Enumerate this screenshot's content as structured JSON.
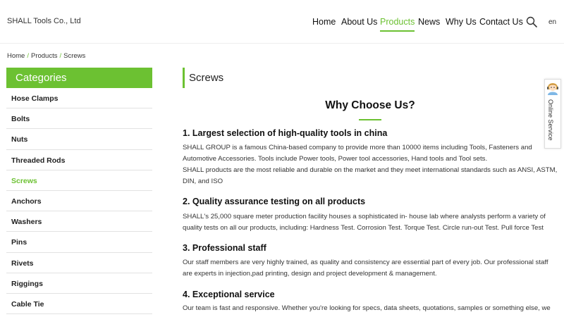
{
  "header": {
    "company": "SHALL Tools Co., Ltd",
    "nav": [
      {
        "label": "Home"
      },
      {
        "label": "About Us"
      },
      {
        "label": "Products"
      },
      {
        "label": "News"
      },
      {
        "label": "Why Us"
      },
      {
        "label": "Contact Us"
      }
    ],
    "active_nav": "Products",
    "search_icon": "search-icon",
    "lang": "en"
  },
  "breadcrumb": {
    "items": [
      "Home",
      "Products",
      "Screws"
    ],
    "separator": "/"
  },
  "sidebar": {
    "title": "Categories",
    "items": [
      {
        "label": "Hose Clamps"
      },
      {
        "label": "Bolts"
      },
      {
        "label": "Nuts"
      },
      {
        "label": "Threaded Rods"
      },
      {
        "label": "Screws"
      },
      {
        "label": "Anchors"
      },
      {
        "label": "Washers"
      },
      {
        "label": "Pins"
      },
      {
        "label": "Rivets"
      },
      {
        "label": "Riggings"
      },
      {
        "label": "Cable Tie"
      }
    ],
    "active_item": "Screws"
  },
  "main": {
    "page_title": "Screws",
    "why_title": "Why Choose Us?",
    "sections": [
      {
        "title": "1. Largest selection of high-quality tools in china",
        "text": "SHALL GROUP is a famous China-based company to provide more than 10000 items including Tools, Fasteners and Automotive Accessories. Tools include Power tools, Power tool accessories, Hand tools and Tool sets.",
        "text2": "SHALL products are the most reliable and durable on the market and they meet international standards such as ANSI, ASTM, DIN, and ISO"
      },
      {
        "title": "2. Quality assurance testing on all products",
        "text": "SHALL's 25,000 square meter production facility houses a sophisticated in- house lab where analysts perform a variety of quality tests on all our products, including: Hardness Test. Corrosion Test. Torque Test. Circle run-out Test. Pull force Test"
      },
      {
        "title": "3. Professional staff",
        "text": "Our staff members are very highly trained, as quality and consistency are essential part of every job. Our professional staff are experts in injection,pad printing, design and project development & management."
      },
      {
        "title": "4. Exceptional service",
        "text": "Our team is fast and responsive. Whether you're looking for specs, data sheets, quotations, samples or something else, we"
      }
    ]
  },
  "online_service": {
    "label": "Online Service",
    "icon": "support-avatar-icon"
  },
  "colors": {
    "accent": "#6cc132",
    "text": "#222222",
    "divider": "#e2e2e2"
  }
}
